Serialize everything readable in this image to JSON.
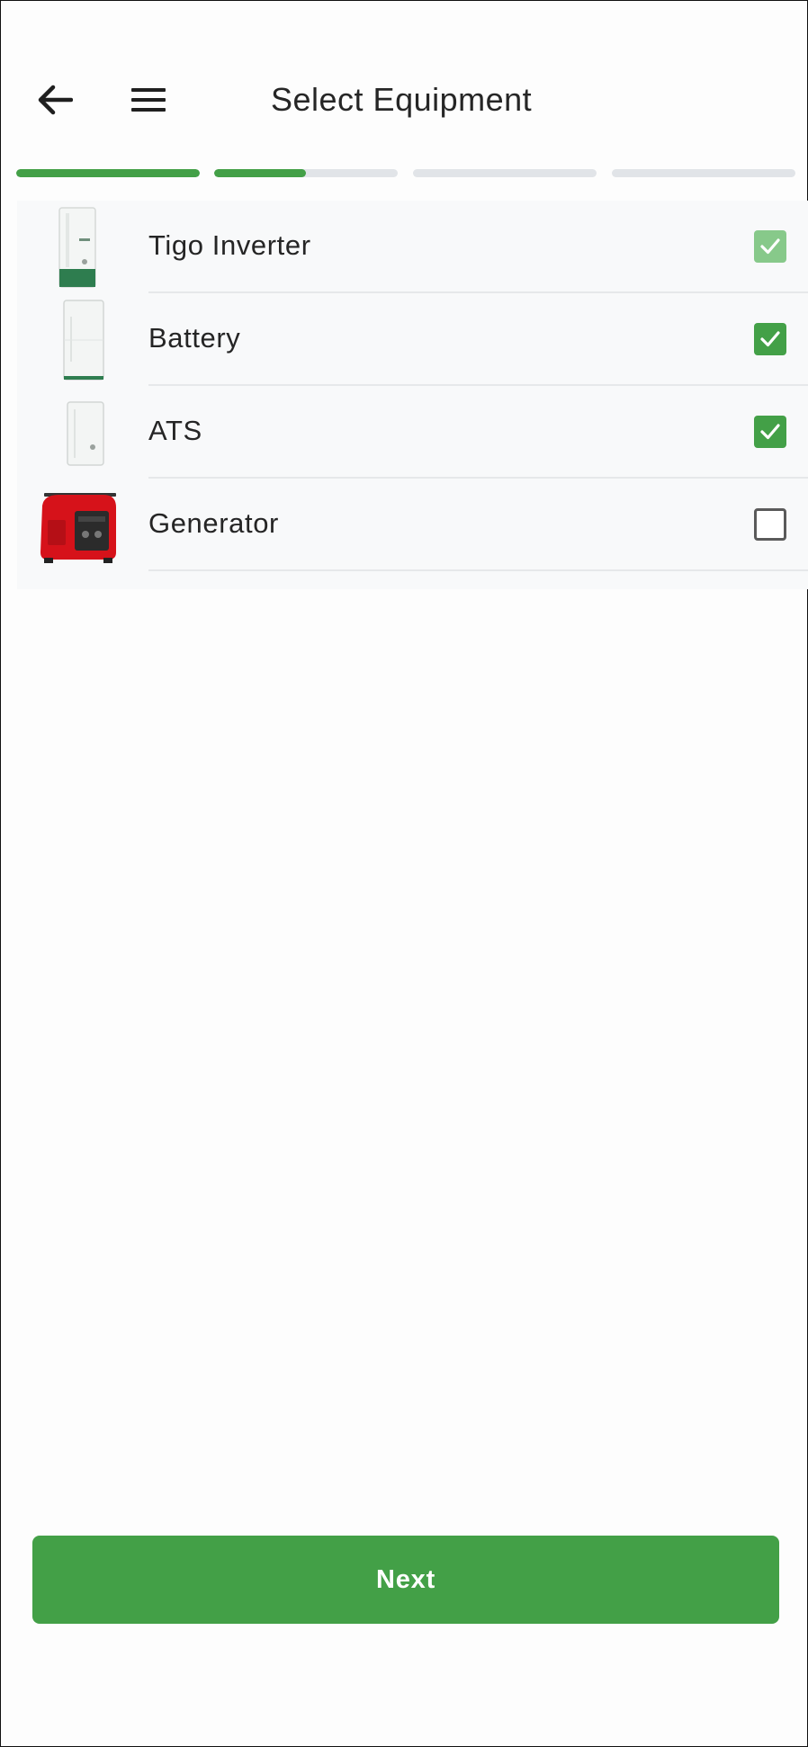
{
  "header": {
    "title": "Select Equipment",
    "back_icon": "arrow-left-icon",
    "menu_icon": "hamburger-menu-icon"
  },
  "progress": {
    "steps": [
      {
        "fill": 1.0
      },
      {
        "fill": 0.5
      },
      {
        "fill": 0.0
      },
      {
        "fill": 0.0
      }
    ],
    "active_color": "#43a047",
    "inactive_color": "#e1e4e8"
  },
  "equipment": [
    {
      "label": "Tigo Inverter",
      "checked": true,
      "disabled": true,
      "icon": "inverter-image"
    },
    {
      "label": "Battery",
      "checked": true,
      "disabled": false,
      "icon": "battery-image"
    },
    {
      "label": "ATS",
      "checked": true,
      "disabled": false,
      "icon": "ats-image"
    },
    {
      "label": "Generator",
      "checked": false,
      "disabled": false,
      "icon": "generator-image"
    }
  ],
  "footer": {
    "next_label": "Next"
  },
  "colors": {
    "accent": "#43a047",
    "accent_disabled": "#87c98a"
  }
}
